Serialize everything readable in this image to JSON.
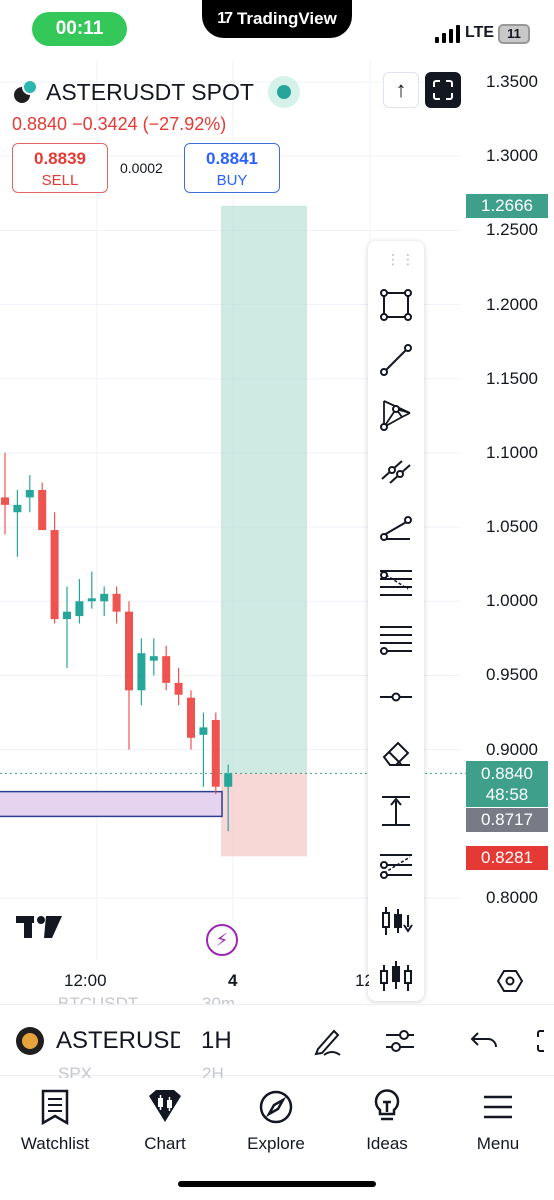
{
  "status": {
    "time": "00:11",
    "island_app": "TradingView",
    "network": "LTE",
    "battery": "11"
  },
  "header": {
    "symbol": "ASTERUSDT SPOT",
    "last_price": "0.8840",
    "change": "−0.3424",
    "change_pct": "(−27.92%)",
    "sell_price": "0.8839",
    "sell_label": "SELL",
    "spread": "0.0002",
    "buy_price": "0.8841",
    "buy_label": "BUY",
    "up_button": "↑"
  },
  "price_scale": {
    "ticks": [
      "1.3500",
      "1.3000",
      "1.2500",
      "1.2000",
      "1.1500",
      "1.1000",
      "1.0500",
      "1.0000",
      "0.9500",
      "0.9000",
      "0.8000"
    ],
    "target_label": "1.2666",
    "current_label": "0.8840",
    "countdown": "48:58",
    "entry_label": "0.8717",
    "stop_label": "0.8281",
    "colors": {
      "target": "#3ea08b",
      "current": "#3ea08b",
      "entry": "#787b86",
      "stop": "#e53935"
    }
  },
  "time_scale": {
    "labels": [
      "12:00",
      "4",
      "12"
    ]
  },
  "toolbar": {
    "tools": [
      "rectangle-icon",
      "trend-line-icon",
      "xabcd-pattern-icon",
      "parallel-channel-icon",
      "ray-icon",
      "pitchfork-icon",
      "horizontal-lines-icon",
      "horizontal-ray-icon",
      "eraser-icon",
      "measure-icon",
      "fib-icon",
      "candles-down-icon",
      "candles-icon"
    ]
  },
  "ghost_list": {
    "item1": "BTCUSDT",
    "item1_interval": "30m",
    "item2": "SPX",
    "item2_interval": "2H"
  },
  "symbol_bar": {
    "symbol": "ASTERUSDT",
    "interval": "1H"
  },
  "nav": {
    "items": [
      "Watchlist",
      "Chart",
      "Explore",
      "Ideas",
      "Menu"
    ]
  },
  "chart_data": {
    "type": "candlestick",
    "interval": "1H",
    "candles": [
      {
        "o": 1.07,
        "h": 1.1,
        "l": 1.045,
        "c": 1.065
      },
      {
        "o": 1.06,
        "h": 1.075,
        "l": 1.03,
        "c": 1.065
      },
      {
        "o": 1.07,
        "h": 1.085,
        "l": 1.06,
        "c": 1.075
      },
      {
        "o": 1.075,
        "h": 1.08,
        "l": 1.05,
        "c": 1.048
      },
      {
        "o": 1.048,
        "h": 1.06,
        "l": 0.985,
        "c": 0.988
      },
      {
        "o": 0.988,
        "h": 1.01,
        "l": 0.955,
        "c": 0.993
      },
      {
        "o": 0.99,
        "h": 1.015,
        "l": 0.985,
        "c": 1.0
      },
      {
        "o": 1.0,
        "h": 1.02,
        "l": 0.995,
        "c": 1.002
      },
      {
        "o": 1.0,
        "h": 1.01,
        "l": 0.99,
        "c": 1.005
      },
      {
        "o": 1.005,
        "h": 1.01,
        "l": 0.985,
        "c": 0.993
      },
      {
        "o": 0.993,
        "h": 1.0,
        "l": 0.9,
        "c": 0.94
      },
      {
        "o": 0.94,
        "h": 0.975,
        "l": 0.93,
        "c": 0.965
      },
      {
        "o": 0.96,
        "h": 0.975,
        "l": 0.95,
        "c": 0.963
      },
      {
        "o": 0.963,
        "h": 0.97,
        "l": 0.94,
        "c": 0.945
      },
      {
        "o": 0.945,
        "h": 0.955,
        "l": 0.93,
        "c": 0.937
      },
      {
        "o": 0.935,
        "h": 0.94,
        "l": 0.9,
        "c": 0.908
      },
      {
        "o": 0.91,
        "h": 0.925,
        "l": 0.875,
        "c": 0.915
      },
      {
        "o": 0.92,
        "h": 0.925,
        "l": 0.87,
        "c": 0.875
      },
      {
        "o": 0.875,
        "h": 0.89,
        "l": 0.845,
        "c": 0.884
      }
    ],
    "position": {
      "target": 1.2666,
      "entry": 0.884,
      "stop": 0.8281
    },
    "support_zone": {
      "top": 0.8717,
      "bottom": 0.855
    },
    "ylim": [
      0.775,
      1.365
    ]
  }
}
